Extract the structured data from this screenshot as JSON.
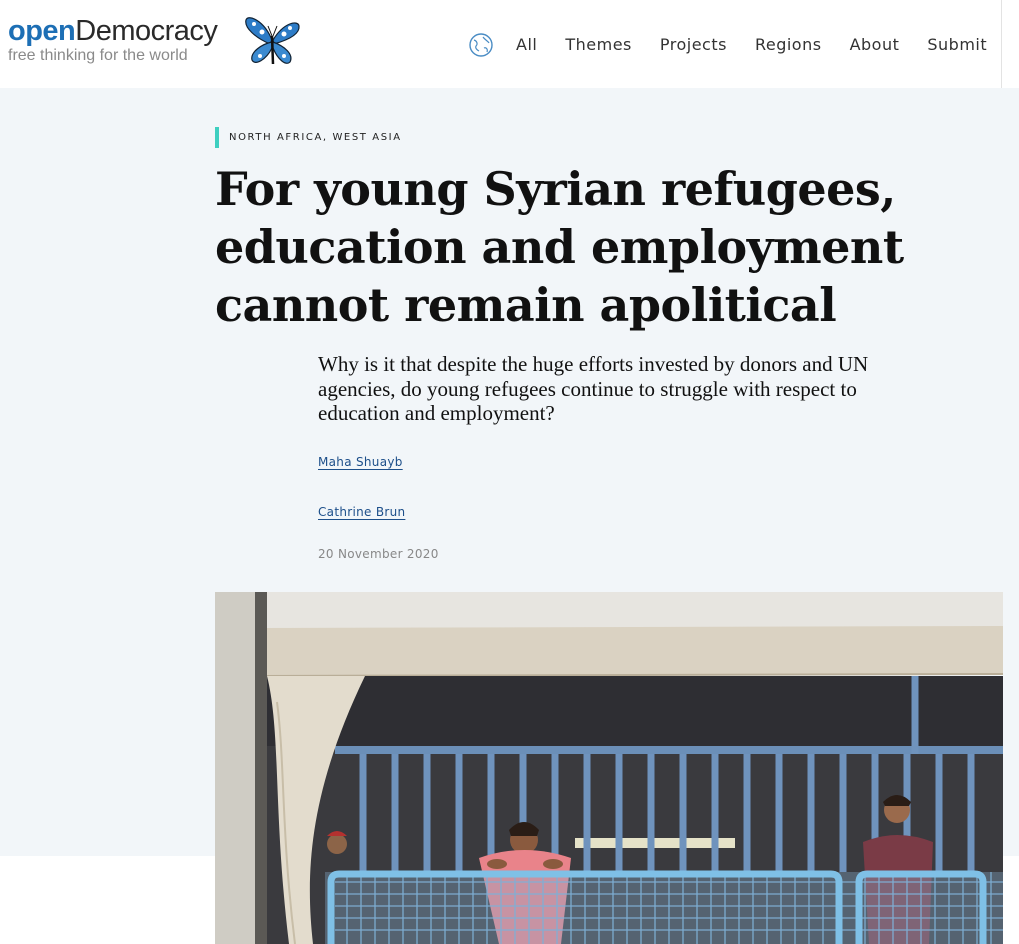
{
  "site": {
    "logo_open": "open",
    "logo_democracy": "Democracy",
    "tagline": "free thinking for the world",
    "logo_icon": "butterfly-logo",
    "brand_color": "#1d6fb5"
  },
  "nav": {
    "globe_icon": "globe-icon",
    "items": [
      {
        "label": "All"
      },
      {
        "label": "Themes"
      },
      {
        "label": "Projects"
      },
      {
        "label": "Regions"
      },
      {
        "label": "About"
      },
      {
        "label": "Submit"
      }
    ]
  },
  "article": {
    "section_tag": "NORTH AFRICA, WEST ASIA",
    "title": "For young Syrian refugees, education and employment cannot remain apolitical",
    "standfirst": "Why is it that despite the huge efforts invested by donors and UN agencies, do young refugees continue to struggle with respect to education and employment?",
    "authors": [
      "Maha Shuayb",
      "Cathrine Brun"
    ],
    "date": "20 November 2020",
    "tag_color": "#3ecfc0",
    "hero_bg": "#f2f6f9"
  }
}
